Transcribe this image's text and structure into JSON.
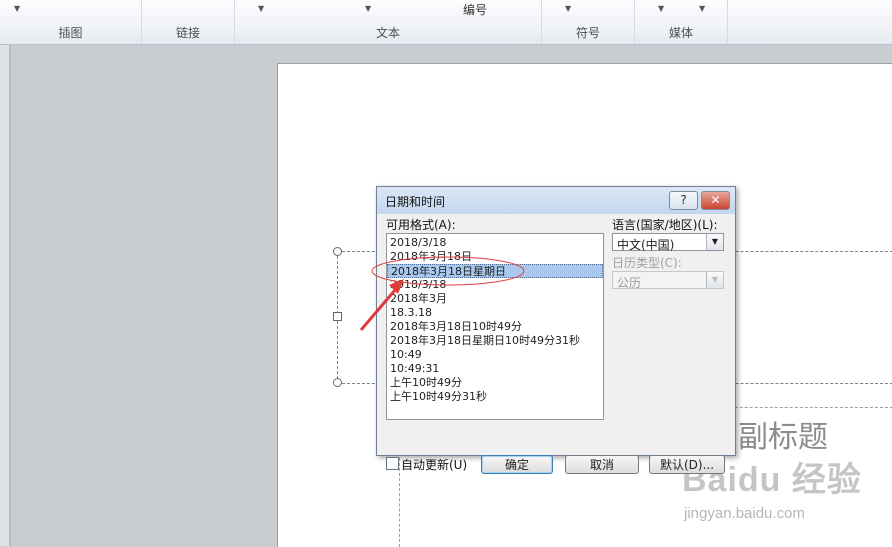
{
  "ribbon": {
    "groups": [
      {
        "label": "插图"
      },
      {
        "label": "链接"
      },
      {
        "label": "文本",
        "top_label": "编号"
      },
      {
        "label": "符号"
      },
      {
        "label": "媒体"
      }
    ]
  },
  "slide": {
    "subtitle_placeholder": "副标题"
  },
  "watermark": {
    "text": "Baidu 经验",
    "url": "jingyan.baidu.com"
  },
  "dialog": {
    "title": "日期和时间",
    "help_glyph": "?",
    "close_glyph": "✕",
    "formats_label": "可用格式(A):",
    "formats": [
      "2018/3/18",
      "2018年3月18日",
      "2018年3月18日星期日",
      "2018/3/18",
      "2018年3月",
      "18.3.18",
      "2018年3月18日10时49分",
      "2018年3月18日星期日10时49分31秒",
      "10:49",
      "10:49:31",
      "上午10时49分",
      "上午10时49分31秒"
    ],
    "selected_index": 2,
    "language_label": "语言(国家/地区)(L):",
    "language_value": "中文(中国)",
    "calendar_label": "日历类型(C):",
    "calendar_value": "公历",
    "auto_update_label": "自动更新(U)",
    "auto_update_checked": false,
    "ok_label": "确定",
    "cancel_label": "取消",
    "default_label": "默认(D)..."
  },
  "colors": {
    "highlight_ellipse": "#e04040",
    "arrow": "#e03a3a",
    "selection": "#a9c8ee"
  }
}
